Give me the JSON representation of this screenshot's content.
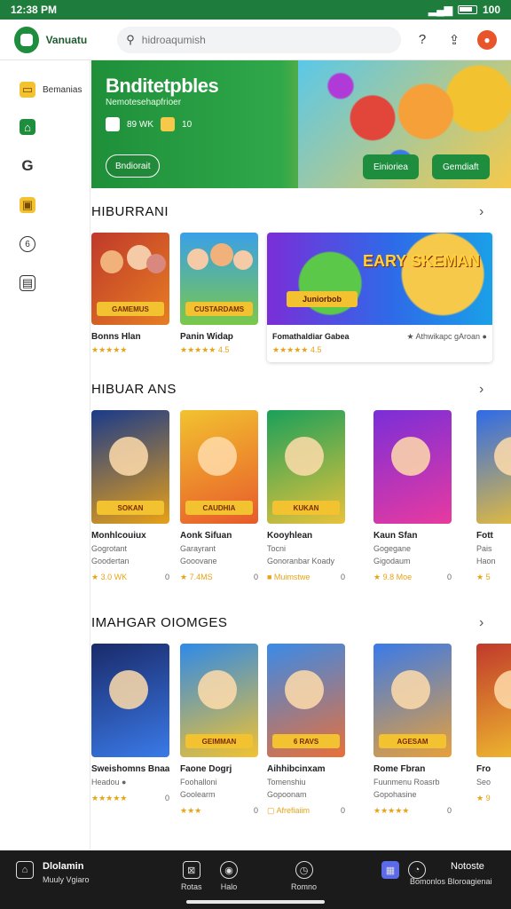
{
  "status": {
    "time": "12:38 PM",
    "battery": "100"
  },
  "topbar": {
    "brand": "Vanuatu",
    "search_placeholder": "hidroaqumish"
  },
  "sidebar": {
    "items": [
      {
        "label": "Bemanias",
        "icon": "games-icon",
        "color": "#f2c230"
      },
      {
        "label": "",
        "icon": "apps-icon",
        "color": "#1e8e3e"
      },
      {
        "label": "",
        "icon": "google-icon",
        "color": "#333333"
      },
      {
        "label": "",
        "icon": "books-icon",
        "color": "#f2c230"
      },
      {
        "label": "",
        "icon": "kids-icon",
        "color": "#333333"
      },
      {
        "label": "",
        "icon": "library-icon",
        "color": "#333333"
      }
    ]
  },
  "hero": {
    "title": "Bnditetpbles",
    "subtitle": "Nemotesehapfrioer",
    "meta_text": "89 WK",
    "meta_count": "10",
    "button_outline": "Bndiorait",
    "button_1": "Einioriea",
    "button_2": "Gemdiaft"
  },
  "sections": [
    {
      "title": "HIBURRANI"
    },
    {
      "title": "HIBUAR ANS"
    },
    {
      "title": "IMAHGAR OIOMGES"
    }
  ],
  "row1": [
    {
      "name": "Bonns Hlan",
      "rating": "★★★★★",
      "badge": "GAMEMUS",
      "colors": [
        "#c0392b",
        "#e67e22"
      ]
    },
    {
      "name": "Panin Widap",
      "rating": "★★★★★ 4.5",
      "badge": "CUSTARDAMS",
      "colors": [
        "#3aa0e8",
        "#7ac84a"
      ]
    }
  ],
  "bigcard": {
    "badge_left": "Juniorbob",
    "badge_right": "EARY SKEMAN",
    "name": "Fomathaldiar Gabea",
    "rating": "★★★★★ 4.5",
    "meta": "★ Athwikapc gAroan ●"
  },
  "row2": [
    {
      "name": "Monhlcouiux",
      "sub": "Gogrotant",
      "sub2": "Goodertan",
      "rating": "★ 3.0 WK",
      "count": "0",
      "badge": "SOKAN",
      "colors": [
        "#1a3a8a",
        "#e8a017"
      ]
    },
    {
      "name": "Aonk Sifuan",
      "sub": "Garayrant",
      "sub2": "Gooovane",
      "rating": "★ 7.4MS",
      "count": "0",
      "badge": "CAUDHIA",
      "colors": [
        "#f2c230",
        "#e85a2a"
      ]
    },
    {
      "name": "Kooyhlean",
      "sub": "Tocni",
      "sub2": "Gonoranbar Koady",
      "rating": "■ Muimstwe",
      "count": "0",
      "badge": "KUKAN",
      "colors": [
        "#1aa05a",
        "#e8c23a"
      ]
    },
    {
      "name": "Kaun Sfan",
      "sub": "Gogegane",
      "sub2": "Gigodaum",
      "rating": "★ 9.8 Moe",
      "count": "0",
      "badge": "",
      "colors": [
        "#7a2ed8",
        "#e83aa0"
      ]
    },
    {
      "name": "Fott",
      "sub": "Pais",
      "sub2": "Haon",
      "rating": "★ 5",
      "count": "",
      "badge": "",
      "colors": [
        "#2e6ae8",
        "#f2c230"
      ]
    }
  ],
  "row3": [
    {
      "name": "Sweishomns Bnaa",
      "sub": "Headou ●",
      "rating": "★★★★★",
      "count": "0",
      "badge": "",
      "colors": [
        "#1a2a6a",
        "#3a7ae8"
      ]
    },
    {
      "name": "Faone Dogrj",
      "sub": "Foohalloni",
      "sub2": "Goolearm",
      "rating": "★★★",
      "count": "0",
      "badge": "GEIMMAN",
      "colors": [
        "#2e8ae8",
        "#f2c230"
      ]
    },
    {
      "name": "Aihhibcinxam",
      "sub": "Tomenshiu",
      "sub2": "Gopoonam",
      "rating": "▢ Afrefiaiim",
      "count": "0",
      "badge": "6 RAVS",
      "colors": [
        "#3a8ae8",
        "#e8703a"
      ]
    },
    {
      "name": "Rome Fbran",
      "sub": "Fuunmenu Roasrb",
      "sub2": "Gopohasine",
      "rating": "★★★★★",
      "count": "0",
      "badge": "AGESAM",
      "colors": [
        "#3a7ae8",
        "#e8a03a"
      ]
    },
    {
      "name": "Fro",
      "sub": "Seo",
      "rating": "★ 9",
      "count": "",
      "badge": "",
      "colors": [
        "#c0392b",
        "#f2c230"
      ]
    }
  ],
  "bottomnav": {
    "left_title": "Dlolamin",
    "left_sub": "Muuly Vgiaro",
    "item1": "Rotas",
    "item2": "Halo",
    "item3": "Romno",
    "right_title": "Notoste",
    "right_sub": "Bomonlos Bloroagienai"
  }
}
